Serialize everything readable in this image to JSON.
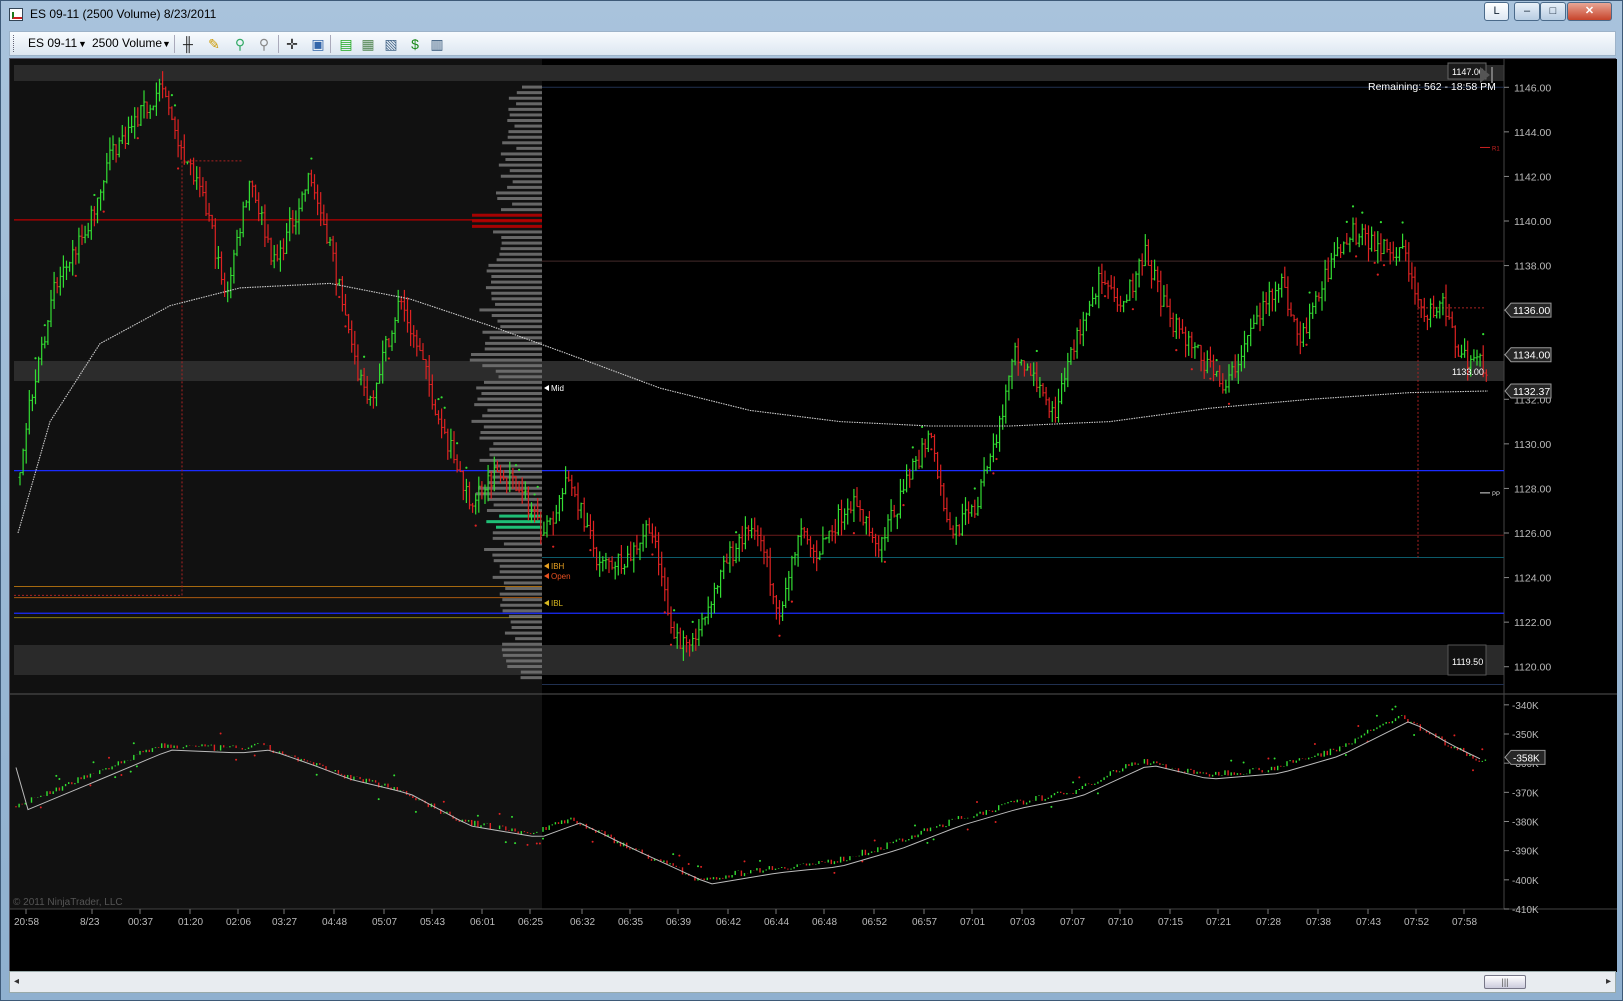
{
  "window": {
    "title": "ES 09-11 (2500 Volume)  8/23/2011",
    "buttons": {
      "layout": "L",
      "minimize": "‒",
      "maximize": "□",
      "close": "✕"
    }
  },
  "toolbar": {
    "instrument": "ES 09-11",
    "interval": "2500 Volume",
    "icons": [
      "bar-type-icon",
      "pencil-draw-icon",
      "chart-trader-icon",
      "zoom-icon",
      "crosshair-icon",
      "data-box-icon",
      "strategies-icon",
      "indicators-icon",
      "properties-icon",
      "dollar-icon",
      "grid-icon"
    ]
  },
  "chart": {
    "remaining": "Remaining: 562 - 18:58 PM",
    "copyright": "© 2011 NinjaTrader, LLC",
    "price_labels": [
      "1146.00",
      "1144.00",
      "1142.00",
      "1140.00",
      "1138.00",
      "1136.00",
      "1134.00",
      "1132.00",
      "1130.00",
      "1128.00",
      "1126.00",
      "1124.00",
      "1122.00",
      "1120.00"
    ],
    "price_flags": {
      "last": "1136.00",
      "ma": "1134.00",
      "ema": "1132.37",
      "high_box": "1147.00",
      "low_box": "1119.50",
      "close_box": "1133.00"
    },
    "markers": {
      "mid": "Mid",
      "ibh": "IBH",
      "open": "Open",
      "ibl": "IBL",
      "r1": "R1",
      "pp": "PP"
    },
    "indicator_labels": [
      "-340K",
      "-350K",
      "-360K",
      "-370K",
      "-380K",
      "-390K",
      "-400K",
      "-410K"
    ],
    "indicator_flag": "-358K",
    "time_labels": [
      "20:58",
      "8/23",
      "00:37",
      "01:20",
      "02:06",
      "03:27",
      "04:48",
      "05:07",
      "05:43",
      "06:01",
      "06:25",
      "06:32",
      "06:35",
      "06:39",
      "06:42",
      "06:44",
      "06:48",
      "06:52",
      "06:57",
      "07:01",
      "07:03",
      "07:07",
      "07:10",
      "07:15",
      "07:21",
      "07:28",
      "07:38",
      "07:43",
      "07:52",
      "07:58"
    ],
    "colors": {
      "up": "#33dd33",
      "down": "#dd2222",
      "background": "#000000",
      "session_shade": "#111111",
      "blue_level": "#1a2bff"
    }
  },
  "chart_data": {
    "type": "bar",
    "instrument": "ES 09-11",
    "interval": "2500 Volume",
    "ylim": [
      1119,
      1147
    ],
    "levels": {
      "high": 1147.0,
      "low": 1119.5,
      "last": 1136.0,
      "ma": 1134.0,
      "ema": 1132.37,
      "close": 1133.0,
      "blue_upper": 1128.8,
      "blue_lower": 1122.4
    },
    "indicator_ylim": [
      -410000,
      -338000
    ],
    "indicator_last": -358000
  },
  "scrollbar": {
    "left_arrow": "◂",
    "right_arrow": "▸",
    "thumb": "|||"
  }
}
